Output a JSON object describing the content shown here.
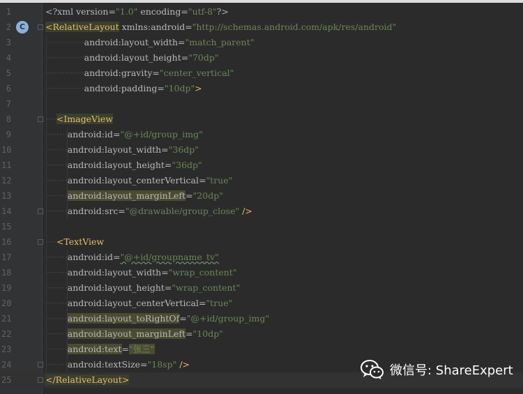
{
  "editor": {
    "lines": [
      {
        "num": "1",
        "segments": [
          {
            "t": "punc",
            "s": "<?xml "
          },
          {
            "t": "attr",
            "s": "version="
          },
          {
            "t": "val",
            "s": "\"1.0\""
          },
          {
            "t": "attr",
            "s": " encoding="
          },
          {
            "t": "val",
            "s": "\"utf-8\""
          },
          {
            "t": "punc",
            "s": "?>"
          }
        ]
      },
      {
        "num": "2",
        "segments": [
          {
            "t": "tag hl-tag",
            "s": "<RelativeLayout"
          },
          {
            "t": "attr",
            "s": " xmlns:android="
          },
          {
            "t": "val",
            "s": "\"http://schemas.android.com/apk/res/android\""
          }
        ]
      },
      {
        "num": "3",
        "segments": [
          {
            "t": "ws",
            "s": "··············"
          },
          {
            "t": "attr",
            "s": "android:layout_width="
          },
          {
            "t": "val",
            "s": "\"match_parent\""
          }
        ]
      },
      {
        "num": "4",
        "segments": [
          {
            "t": "ws",
            "s": "··············"
          },
          {
            "t": "attr",
            "s": "android:layout_height="
          },
          {
            "t": "val",
            "s": "\"70dp\""
          }
        ]
      },
      {
        "num": "5",
        "segments": [
          {
            "t": "ws",
            "s": "··············"
          },
          {
            "t": "attr",
            "s": "android:gravity="
          },
          {
            "t": "val",
            "s": "\"center_vertical\""
          }
        ]
      },
      {
        "num": "6",
        "segments": [
          {
            "t": "ws",
            "s": "··············"
          },
          {
            "t": "attr",
            "s": "android:padding="
          },
          {
            "t": "val",
            "s": "\"10dp\""
          },
          {
            "t": "tag",
            "s": ">"
          }
        ]
      },
      {
        "num": "7",
        "segments": []
      },
      {
        "num": "8",
        "segments": [
          {
            "t": "ws",
            "s": "····"
          },
          {
            "t": "tag hl-tag",
            "s": "<ImageView"
          }
        ]
      },
      {
        "num": "9",
        "segments": [
          {
            "t": "ws",
            "s": "········"
          },
          {
            "t": "attr",
            "s": "android:id="
          },
          {
            "t": "val",
            "s": "\"@+id/group_img\""
          }
        ]
      },
      {
        "num": "10",
        "segments": [
          {
            "t": "ws",
            "s": "········"
          },
          {
            "t": "attr",
            "s": "android:layout_width="
          },
          {
            "t": "val",
            "s": "\"36dp\""
          }
        ]
      },
      {
        "num": "11",
        "segments": [
          {
            "t": "ws",
            "s": "········"
          },
          {
            "t": "attr",
            "s": "android:layout_height="
          },
          {
            "t": "val",
            "s": "\"36dp\""
          }
        ]
      },
      {
        "num": "12",
        "segments": [
          {
            "t": "ws",
            "s": "········"
          },
          {
            "t": "attr",
            "s": "android:layout_centerVertical="
          },
          {
            "t": "val",
            "s": "\"true\""
          }
        ]
      },
      {
        "num": "13",
        "segments": [
          {
            "t": "ws",
            "s": "········"
          },
          {
            "t": "attr hl",
            "s": "android:layout_marginLeft"
          },
          {
            "t": "attr",
            "s": "="
          },
          {
            "t": "val",
            "s": "\"20dp\""
          }
        ]
      },
      {
        "num": "14",
        "segments": [
          {
            "t": "ws",
            "s": "········"
          },
          {
            "t": "attr",
            "s": "android:src="
          },
          {
            "t": "val",
            "s": "\"@drawable/group_close\""
          },
          {
            "t": "tag",
            "s": " />"
          }
        ]
      },
      {
        "num": "15",
        "segments": []
      },
      {
        "num": "16",
        "segments": [
          {
            "t": "ws",
            "s": "····"
          },
          {
            "t": "tag",
            "s": "<TextView"
          }
        ]
      },
      {
        "num": "17",
        "segments": [
          {
            "t": "ws",
            "s": "········"
          },
          {
            "t": "attr",
            "s": "android:id="
          },
          {
            "t": "val wavy",
            "s": "\"@+id/groupname_tv\""
          }
        ]
      },
      {
        "num": "18",
        "segments": [
          {
            "t": "ws",
            "s": "········"
          },
          {
            "t": "attr",
            "s": "android:layout_width="
          },
          {
            "t": "val",
            "s": "\"wrap_content\""
          }
        ]
      },
      {
        "num": "19",
        "segments": [
          {
            "t": "ws",
            "s": "········"
          },
          {
            "t": "attr",
            "s": "android:layout_height="
          },
          {
            "t": "val",
            "s": "\"wrap_content\""
          }
        ]
      },
      {
        "num": "20",
        "segments": [
          {
            "t": "ws",
            "s": "········"
          },
          {
            "t": "attr",
            "s": "android:layout_centerVertical="
          },
          {
            "t": "val",
            "s": "\"true\""
          }
        ]
      },
      {
        "num": "21",
        "segments": [
          {
            "t": "ws",
            "s": "········"
          },
          {
            "t": "attr hl",
            "s": "android:layout_toRightOf"
          },
          {
            "t": "attr",
            "s": "="
          },
          {
            "t": "val",
            "s": "\"@+id/group_img\""
          }
        ]
      },
      {
        "num": "22",
        "segments": [
          {
            "t": "ws",
            "s": "········"
          },
          {
            "t": "attr hl",
            "s": "android:layout_marginLeft"
          },
          {
            "t": "attr",
            "s": "="
          },
          {
            "t": "val",
            "s": "\"10dp\""
          }
        ]
      },
      {
        "num": "23",
        "segments": [
          {
            "t": "ws",
            "s": "········"
          },
          {
            "t": "attr hl",
            "s": "android:text"
          },
          {
            "t": "attr",
            "s": "="
          },
          {
            "t": "val hl",
            "s": "\"张三\""
          }
        ]
      },
      {
        "num": "24",
        "segments": [
          {
            "t": "ws",
            "s": "········"
          },
          {
            "t": "attr",
            "s": "android:textSize="
          },
          {
            "t": "val",
            "s": "\"18sp\""
          },
          {
            "t": "tag",
            "s": " />"
          }
        ]
      },
      {
        "num": "25",
        "segments": [
          {
            "t": "tag hl-tag",
            "s": "</RelativeLayout>"
          }
        ]
      }
    ],
    "gutter_badge": {
      "label": "C",
      "line": "2",
      "icon": "class-icon"
    },
    "caret_line": "25"
  },
  "watermark": {
    "label": "微信号: ShareExpert",
    "icon": "wechat-icon"
  }
}
